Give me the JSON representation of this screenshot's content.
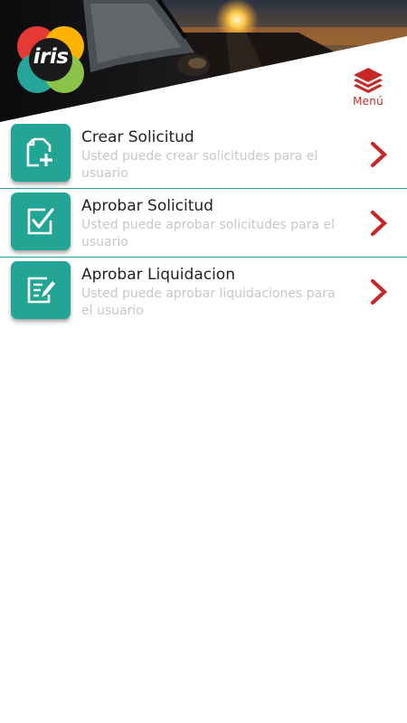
{
  "header": {
    "logo_text": "iris",
    "menu_label": "Menú",
    "menu_icon": "layers-icon"
  },
  "colors": {
    "accent_teal": "#23a595",
    "menu_red": "#c62828",
    "chevron_red": "#c62828",
    "title_text": "#222222",
    "desc_text": "#c3c8cc"
  },
  "options": [
    {
      "title": "Crear Solicitud",
      "description": "Usted puede crear solicitudes para el usuario",
      "icon": "new-document-icon"
    },
    {
      "title": "Aprobar Solicitud",
      "description": "Usted puede aprobar solicitudes para el usuario",
      "icon": "checkbox-icon"
    },
    {
      "title": "Aprobar Liquidacion",
      "description": "Usted puede aprobar liquidaciones para el usuario",
      "icon": "edit-document-icon"
    }
  ]
}
